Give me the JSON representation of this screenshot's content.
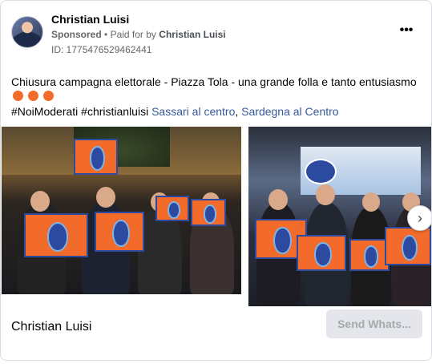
{
  "advertiser": {
    "name": "Christian Luisi",
    "sponsored_label": "Sponsored",
    "separator": "•",
    "paid_for_by_prefix": "Paid for by",
    "paid_for_by": "Christian Luisi",
    "id_line": "ID: 1775476529462441"
  },
  "post": {
    "text": "Chiusura campagna elettorale - Piazza Tola - una grande folla e tanto entusiasmo",
    "emoji": [
      "orange-circle",
      "orange-circle",
      "orange-circle"
    ],
    "hashtag1": "#NoiModerati",
    "hashtag2": "#christianluisi",
    "link1": "Sassari al centro",
    "comma": ",",
    "link2": "Sardegna al Centro"
  },
  "carousel": {
    "next_icon": "›"
  },
  "footer": {
    "name": "Christian Luisi",
    "cta_label": "Send Whats..."
  },
  "colors": {
    "link": "#385898",
    "secondary_text": "#65676b",
    "emoji_orange": "#f36b2a",
    "button_bg": "#e4e6eb",
    "button_text": "#a6a8ad"
  }
}
